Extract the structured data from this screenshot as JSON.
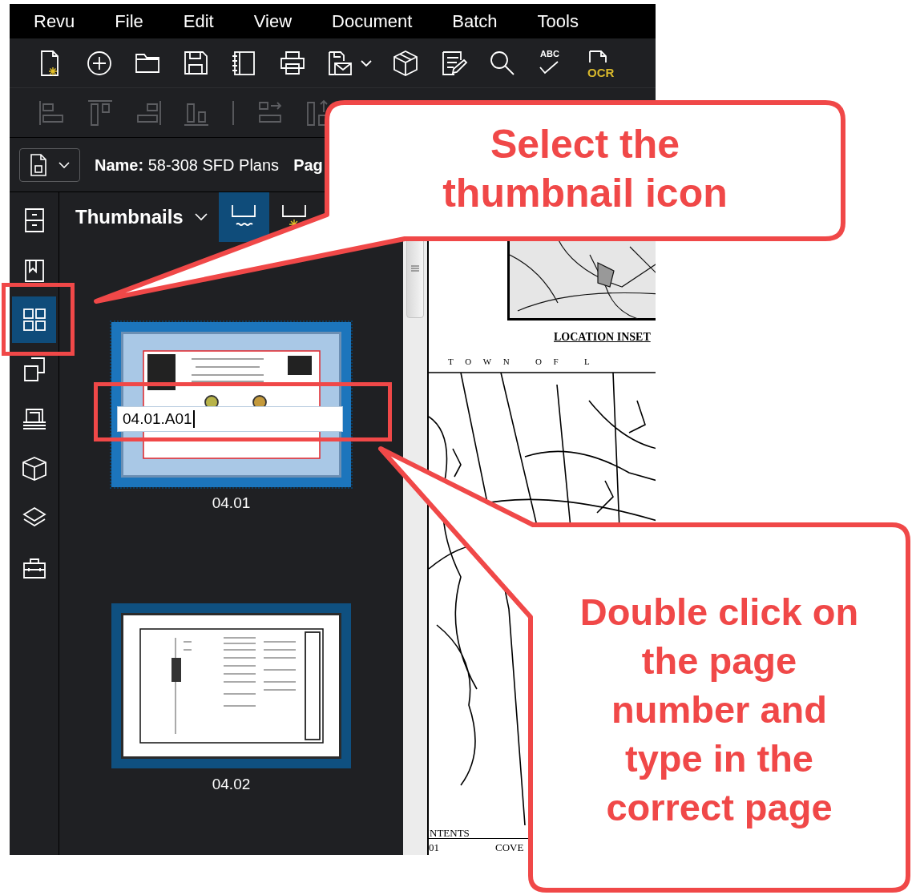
{
  "menu_bar": [
    {
      "label": "Revu"
    },
    {
      "label": "File"
    },
    {
      "label": "Edit"
    },
    {
      "label": "View"
    },
    {
      "label": "Document"
    },
    {
      "label": "Batch"
    },
    {
      "label": "Tools"
    }
  ],
  "toolbar_main": [
    {
      "kind": "new-file"
    },
    {
      "kind": "add"
    },
    {
      "kind": "folder"
    },
    {
      "kind": "save"
    },
    {
      "kind": "notebook"
    },
    {
      "kind": "print"
    },
    {
      "kind": "save-mail"
    },
    {
      "kind": "cube"
    },
    {
      "kind": "edit-doc"
    },
    {
      "kind": "search"
    },
    {
      "kind": "spell",
      "label": "ABC"
    },
    {
      "kind": "ocr",
      "label": "OCR"
    }
  ],
  "toolbar_align": [
    {
      "kind": "align-left",
      "disabled": true
    },
    {
      "kind": "align-top",
      "disabled": true
    },
    {
      "kind": "align-right",
      "disabled": true
    },
    {
      "kind": "align-bottom",
      "disabled": true
    },
    {
      "kind": "separator",
      "disabled": true
    },
    {
      "kind": "distribute-h",
      "disabled": true
    },
    {
      "kind": "distribute-v",
      "disabled": true
    }
  ],
  "document_bar": {
    "name": "**Name:** 58-308 SFD Plans",
    "page_label": "Pag"
  },
  "side_rail": [
    {
      "kind": "file-cabinet",
      "selected": false
    },
    {
      "kind": "bookmark",
      "selected": false
    },
    {
      "kind": "grid",
      "selected": true
    },
    {
      "kind": "pages",
      "selected": false
    },
    {
      "kind": "stack",
      "selected": false
    },
    {
      "kind": "cube-3d",
      "selected": false
    },
    {
      "kind": "layers",
      "selected": false
    },
    {
      "kind": "toolbox",
      "selected": false
    }
  ],
  "panel": {
    "title": "Thumbnails",
    "view_toggles": [
      {
        "kind": "label",
        "selected": true
      },
      {
        "kind": "new",
        "selected": false
      }
    ],
    "thumbnails": [
      {
        "label": "04.01",
        "selected": true,
        "editing": true,
        "value": "04.01.A01"
      },
      {
        "label": "04.02",
        "selected": false,
        "editing": false
      }
    ]
  },
  "document_view": {
    "inset_title": "LOCATION INSET",
    "town_label": "T O W N   O F   L",
    "table_heading": "NTENTS",
    "table_cells": [
      "01",
      "COVE"
    ]
  },
  "annotations": [
    {
      "kind": "callout",
      "text": "Select the\nthumbnail icon"
    },
    {
      "kind": "callout",
      "text": "Double click on\nthe page\nnumber and\ntype in the\ncorrect page"
    },
    {
      "kind": "highlight"
    },
    {
      "kind": "highlight"
    }
  ]
}
